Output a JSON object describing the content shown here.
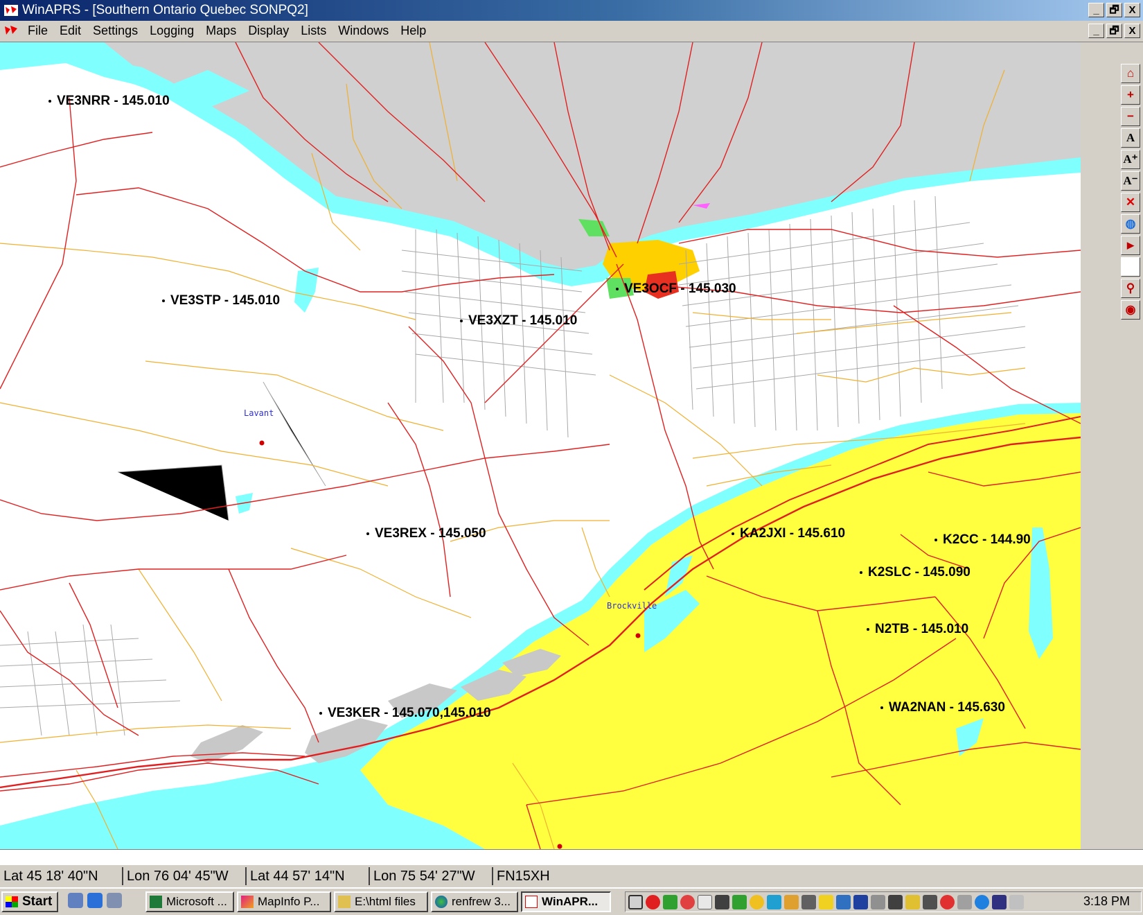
{
  "window": {
    "title": "WinAPRS - [Southern Ontario Quebec SONPQ2]",
    "controls": [
      "_",
      "🗗",
      "X"
    ]
  },
  "menu": {
    "items": [
      "File",
      "Edit",
      "Settings",
      "Logging",
      "Maps",
      "Display",
      "Lists",
      "Windows",
      "Help"
    ],
    "controls": [
      "_",
      "🗗",
      "X"
    ]
  },
  "map": {
    "colors": {
      "water": "#80ffff",
      "land_ny": "#ffff40",
      "land_qc": "#d0d0d0",
      "highway": "#e02020",
      "road": "#f0b030",
      "street": "#a8a8a8"
    },
    "stations": [
      {
        "label": "VE3NRR - 145.010"
      },
      {
        "label": "VE3STP - 145.010"
      },
      {
        "label": "VE3XZT - 145.010"
      },
      {
        "label": "VE3OCF - 145.030"
      },
      {
        "label": "VE3REX - 145.050"
      },
      {
        "label": "KA2JXI - 145.610"
      },
      {
        "label": "K2CC - 144.90"
      },
      {
        "label": "K2SLC - 145.090"
      },
      {
        "label": "N2TB - 145.010"
      },
      {
        "label": "WA2NAN - 145.630"
      },
      {
        "label": "VE3KER - 145.070,145.010"
      }
    ],
    "towns": [
      "Lavant",
      "Brockville"
    ]
  },
  "toolbar": {
    "tools": [
      {
        "icon": "home-icon",
        "glyph": "⌂"
      },
      {
        "icon": "zoom-in-icon",
        "glyph": "+"
      },
      {
        "icon": "zoom-out-icon",
        "glyph": "−"
      },
      {
        "icon": "font-icon",
        "glyph": "A"
      },
      {
        "icon": "font-larger-icon",
        "glyph": "A⁺"
      },
      {
        "icon": "font-smaller-icon",
        "glyph": "A⁻"
      },
      {
        "icon": "delete-icon",
        "glyph": "✕"
      },
      {
        "icon": "globe-icon",
        "glyph": "◍"
      },
      {
        "icon": "play-icon",
        "glyph": "▶"
      },
      {
        "icon": "blank-icon",
        "glyph": ""
      },
      {
        "icon": "locate-icon",
        "glyph": "⚲"
      },
      {
        "icon": "target-icon",
        "glyph": "◉"
      }
    ]
  },
  "coords": {
    "lat1": "Lat  45 18' 40\"N",
    "lon1": "Lon  76 04' 45\"W",
    "lat2": "Lat  44 57' 14\"N",
    "lon2": "Lon  75 54' 27\"W",
    "grid": "FN15XH"
  },
  "taskbar": {
    "start": "Start",
    "tasks": [
      "Microsoft ...",
      "MapInfo P...",
      "E:\\html files",
      "renfrew 3...",
      "WinAPR..."
    ],
    "clock": "3:18 PM"
  }
}
